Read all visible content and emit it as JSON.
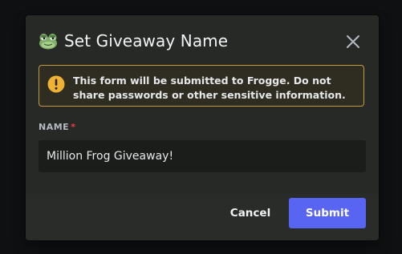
{
  "modal": {
    "title": "Set Giveaway Name",
    "app_icon": "frog-avatar-icon",
    "close_icon": "close-icon"
  },
  "warning": {
    "icon": "warning-icon",
    "text": "This form will be submitted to Frogge. Do not share passwords or other sensitive information."
  },
  "field": {
    "label": "NAME",
    "required_marker": "*",
    "value": "Million Frog Giveaway!"
  },
  "footer": {
    "cancel_label": "Cancel",
    "submit_label": "Submit"
  },
  "colors": {
    "accent": "#5865f2",
    "warning_border": "#c59a3a",
    "warning_icon": "#f0b232",
    "required": "#f23f43"
  }
}
